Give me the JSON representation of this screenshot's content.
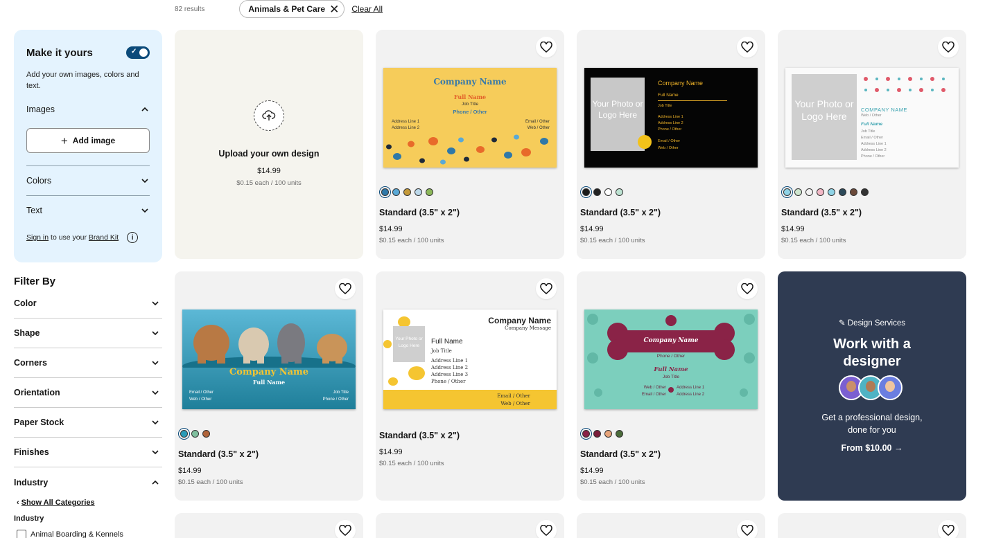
{
  "topbar": {
    "results": "82 results",
    "chip_label": "Animals & Pet Care",
    "clear_all": "Clear All"
  },
  "make_it_yours": {
    "title": "Make it yours",
    "description": "Add your own images, colors and text.",
    "toggle_on": true,
    "images_label": "Images",
    "add_image_label": "Add image",
    "colors_label": "Colors",
    "text_label": "Text",
    "sign_in": "Sign in",
    "brand_mid": "to use your",
    "brand_kit": "Brand Kit"
  },
  "filters": {
    "title": "Filter By",
    "items": [
      "Color",
      "Shape",
      "Corners",
      "Orientation",
      "Paper Stock",
      "Finishes",
      "Industry"
    ],
    "show_all": "Show All Categories",
    "industry_sub": "Industry",
    "first_option": "Animal Boarding & Kennels"
  },
  "upload": {
    "title": "Upload your own design",
    "price": "$14.99",
    "unit": "$0.15 each / 100 units"
  },
  "products": [
    {
      "title": "Standard (3.5\" x 2\")",
      "price": "$14.99",
      "unit": "$0.15 each / 100 units",
      "company": "Company Name",
      "full_name": "Full Name",
      "job": "Job Title",
      "phone": "Phone / Other",
      "addr1": "Address Line 1",
      "addr2": "Address Line 2",
      "email": "Email / Other",
      "web": "Web / Other",
      "swatches": [
        "#2f78a8",
        "#5aa9d6",
        "#c59a3a",
        "#bcd8ea",
        "#8cb85a"
      ]
    },
    {
      "title": "Standard (3.5\" x 2\")",
      "price": "$14.99",
      "unit": "$0.15 each / 100 units",
      "company": "Company Name",
      "full_name": "Full Name",
      "job": "Job Title",
      "addr1": "Address Line 1",
      "addr2": "Address Line 2",
      "phone": "Phone / Other",
      "email": "Email / Other",
      "web": "Web / Other",
      "photo": "Your Photo or Logo Here",
      "swatches": [
        "#1a1a1a",
        "#222222",
        "#ffffff",
        "#bde3d2"
      ]
    },
    {
      "title": "Standard (3.5\" x 2\")",
      "price": "$14.99",
      "unit": "$0.15 each / 100 units",
      "company": "COMPANY NAME",
      "web": "Web / Other",
      "full_name": "Full Name",
      "job": "Job Title",
      "email": "Email / Other",
      "addr1": "Address Line 1",
      "addr2": "Address Line 2",
      "phone": "Phone / Other",
      "photo": "Your Photo or Logo Here",
      "swatches": [
        "#8fd3e6",
        "#cfe6cf",
        "#f2f2f2",
        "#f2b8c6",
        "#8fd3e6",
        "#2d4a5a",
        "#6b4a3a",
        "#333333"
      ]
    },
    {
      "title": "Standard (3.5\" x 2\")",
      "price": "$14.99",
      "unit": "$0.15 each / 100 units",
      "company": "Company Name",
      "full_name": "Full Name",
      "email": "Email / Other",
      "web": "Web / Other",
      "job": "Job Title",
      "phone": "Phone / Other",
      "swatches": [
        "#2a9bb8",
        "#7fbf9e",
        "#b0643a"
      ]
    },
    {
      "title": "Standard (3.5\" x 2\")",
      "price": "$14.99",
      "unit": "$0.15 each / 100 units",
      "company": "Company Name",
      "message": "Company Message",
      "full_name": "Full Name",
      "job": "Job Title",
      "addr1": "Address Line 1",
      "addr2": "Address Line 2",
      "addr3": "Address Line 3",
      "phone": "Phone / Other",
      "email": "Email / Other",
      "web": "Web / Other",
      "photo": "Your Photo or Logo Here"
    },
    {
      "title": "Standard (3.5\" x 2\")",
      "price": "$14.99",
      "unit": "$0.15 each / 100 units",
      "company": "Company Name",
      "phone": "Phone / Other",
      "full_name": "Full Name",
      "job": "Job Title",
      "web": "Web / Other",
      "email": "Email / Other",
      "addr1": "Address Line 1",
      "addr2": "Address Line 2",
      "swatches": [
        "#8a2347",
        "#7a1d3a",
        "#e7a47a",
        "#4a6b3a"
      ]
    }
  ],
  "design_services": {
    "tag": "Design Services",
    "title": "Work with a designer",
    "desc": "Get a professional design, done for you",
    "from": "From $10.00"
  }
}
